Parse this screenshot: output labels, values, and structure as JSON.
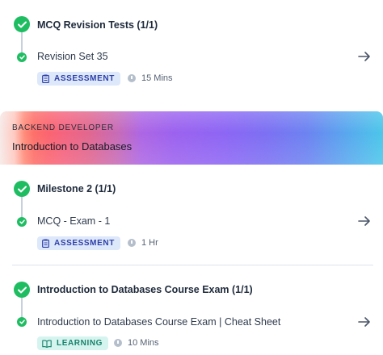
{
  "sections": [
    {
      "title": "MCQ Revision Tests (1/1)",
      "item": {
        "label": "Revision Set 35",
        "badge": "ASSESSMENT",
        "badge_icon": "clipboard-icon",
        "duration": "15 Mins"
      }
    },
    {
      "title": "Milestone 2 (1/1)",
      "item": {
        "label": "MCQ - Exam - 1",
        "badge": "ASSESSMENT",
        "badge_icon": "clipboard-icon",
        "duration": "1 Hr"
      }
    },
    {
      "title": "Introduction to Databases Course Exam (1/1)",
      "item": {
        "label": "Introduction to Databases Course Exam | Cheat Sheet",
        "badge": "LEARNING",
        "badge_icon": "book-icon",
        "duration": "10 Mins"
      }
    }
  ],
  "banner": {
    "kicker": "BACKEND DEVELOPER",
    "title": "Introduction to Databases"
  },
  "colors": {
    "complete": "#1fbd62",
    "assessment_bg": "#dde8fb",
    "assessment_text": "#2e3fa8",
    "learning_bg": "#d6f4ef",
    "learning_text": "#17826b"
  },
  "icons": {
    "status": "check-circle-icon",
    "open": "arrow-right-icon",
    "duration": "clock-icon"
  }
}
